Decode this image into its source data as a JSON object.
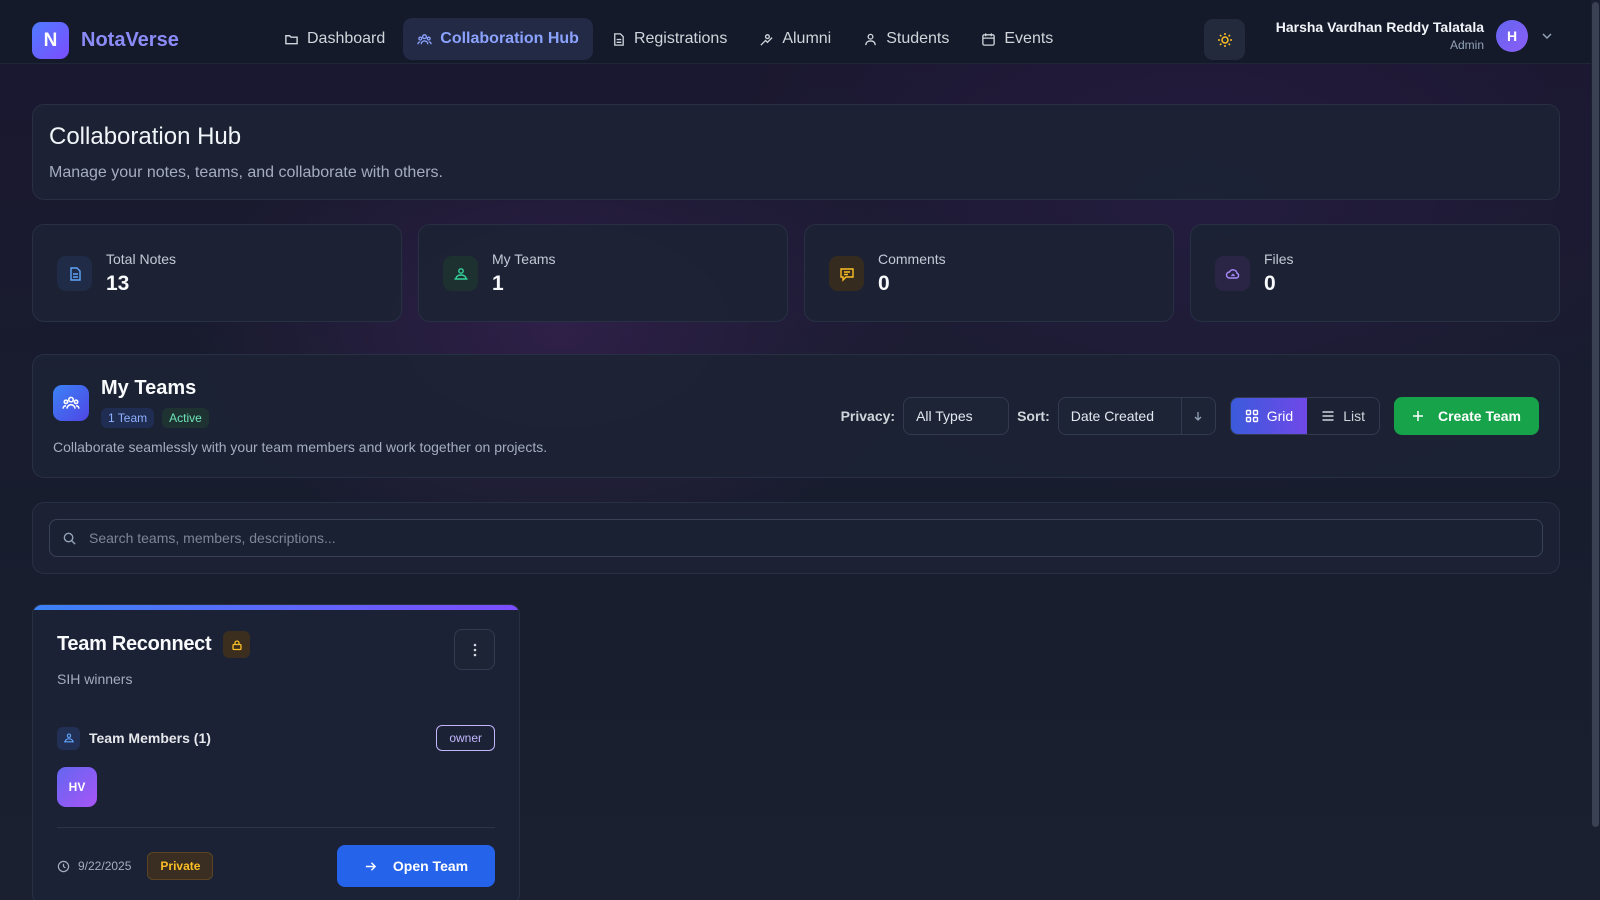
{
  "app": {
    "logo_letter": "N",
    "name": "NotaVerse"
  },
  "nav": [
    {
      "label": "Dashboard",
      "icon": "folder-icon",
      "active": false
    },
    {
      "label": "Collaboration Hub",
      "icon": "users-icon",
      "active": true
    },
    {
      "label": "Registrations",
      "icon": "document-icon",
      "active": false
    },
    {
      "label": "Alumni",
      "icon": "alumni-icon",
      "active": false
    },
    {
      "label": "Students",
      "icon": "user-icon",
      "active": false
    },
    {
      "label": "Events",
      "icon": "calendar-icon",
      "active": false
    }
  ],
  "user": {
    "name": "Harsha Vardhan Reddy Talatala",
    "role": "Admin",
    "initial": "H"
  },
  "page": {
    "title": "Collaboration Hub",
    "subtitle": "Manage your notes, teams, and collaborate with others."
  },
  "stats": [
    {
      "label": "Total Notes",
      "value": "13",
      "icon": "notes-icon",
      "color": "#60a5fa"
    },
    {
      "label": "My Teams",
      "value": "1",
      "icon": "team-icon",
      "color": "#34d399"
    },
    {
      "label": "Comments",
      "value": "0",
      "icon": "comment-icon",
      "color": "#fbbf24"
    },
    {
      "label": "Files",
      "value": "0",
      "icon": "cloud-icon",
      "color": "#a78bfa"
    }
  ],
  "teams_section": {
    "title": "My Teams",
    "count_badge": "1 Team",
    "status_badge": "Active",
    "description": "Collaborate seamlessly with your team members and work together on projects.",
    "privacy_label": "Privacy:",
    "privacy_value": "All Types",
    "sort_label": "Sort:",
    "sort_value": "Date Created",
    "view_grid": "Grid",
    "view_list": "List",
    "create_label": "Create Team"
  },
  "search": {
    "placeholder": "Search teams, members, descriptions..."
  },
  "team_card": {
    "name": "Team Reconnect",
    "description": "SIH winners",
    "members_label": "Team Members (1)",
    "role_badge": "owner",
    "member_initials": "HV",
    "date": "9/22/2025",
    "privacy": "Private",
    "open_label": "Open Team"
  },
  "colors": {
    "accent": "#8ca2ff",
    "create": "#16a34a",
    "open": "#2563eb",
    "private": "#fbbf24"
  }
}
